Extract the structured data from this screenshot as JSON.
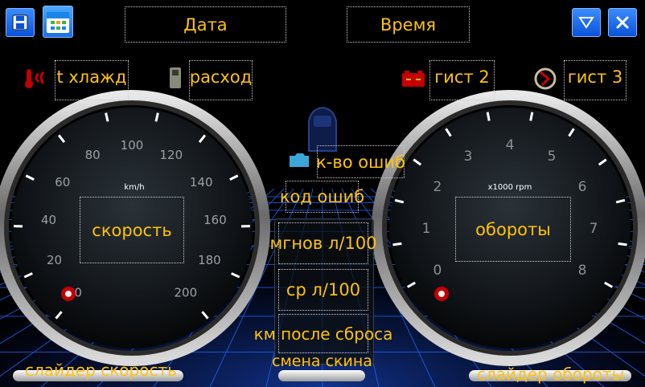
{
  "top": {
    "date_label": "Дата",
    "time_label": "Время"
  },
  "params": {
    "coolant_temp": "t хлажд",
    "consumption": "расход",
    "hyst2": "гист 2",
    "hyst3": "гист 3"
  },
  "speed_gauge": {
    "label": "скорость",
    "unit": "km/h",
    "ticks": [
      "0",
      "20",
      "40",
      "60",
      "80",
      "100",
      "120",
      "140",
      "160",
      "180",
      "200"
    ]
  },
  "rpm_gauge": {
    "label": "обороты",
    "unit": "x1000 rpm",
    "ticks": [
      "0",
      "1",
      "2",
      "3",
      "4",
      "5",
      "6",
      "7",
      "8"
    ]
  },
  "center": {
    "error_count": "к-во ошиб",
    "error_code": "код ошиб",
    "instant_consumption": "мгнов л/100",
    "avg_consumption": "ср л/100",
    "km_after_reset": "км после сброса",
    "change_skin": "смена скина"
  },
  "bottom": {
    "speed_slider": "слайдер скорость",
    "rpm_slider": "слайдер обороты"
  },
  "colors": {
    "text": "#ffc20e",
    "button": "#1565e8",
    "grid": "#1e6bff"
  },
  "icons": [
    "save-icon",
    "calendar-icon",
    "dropdown-icon",
    "close-icon",
    "thermometer-icon",
    "fuel-icon",
    "battery-icon",
    "turbo-icon",
    "engine-check-icon"
  ]
}
